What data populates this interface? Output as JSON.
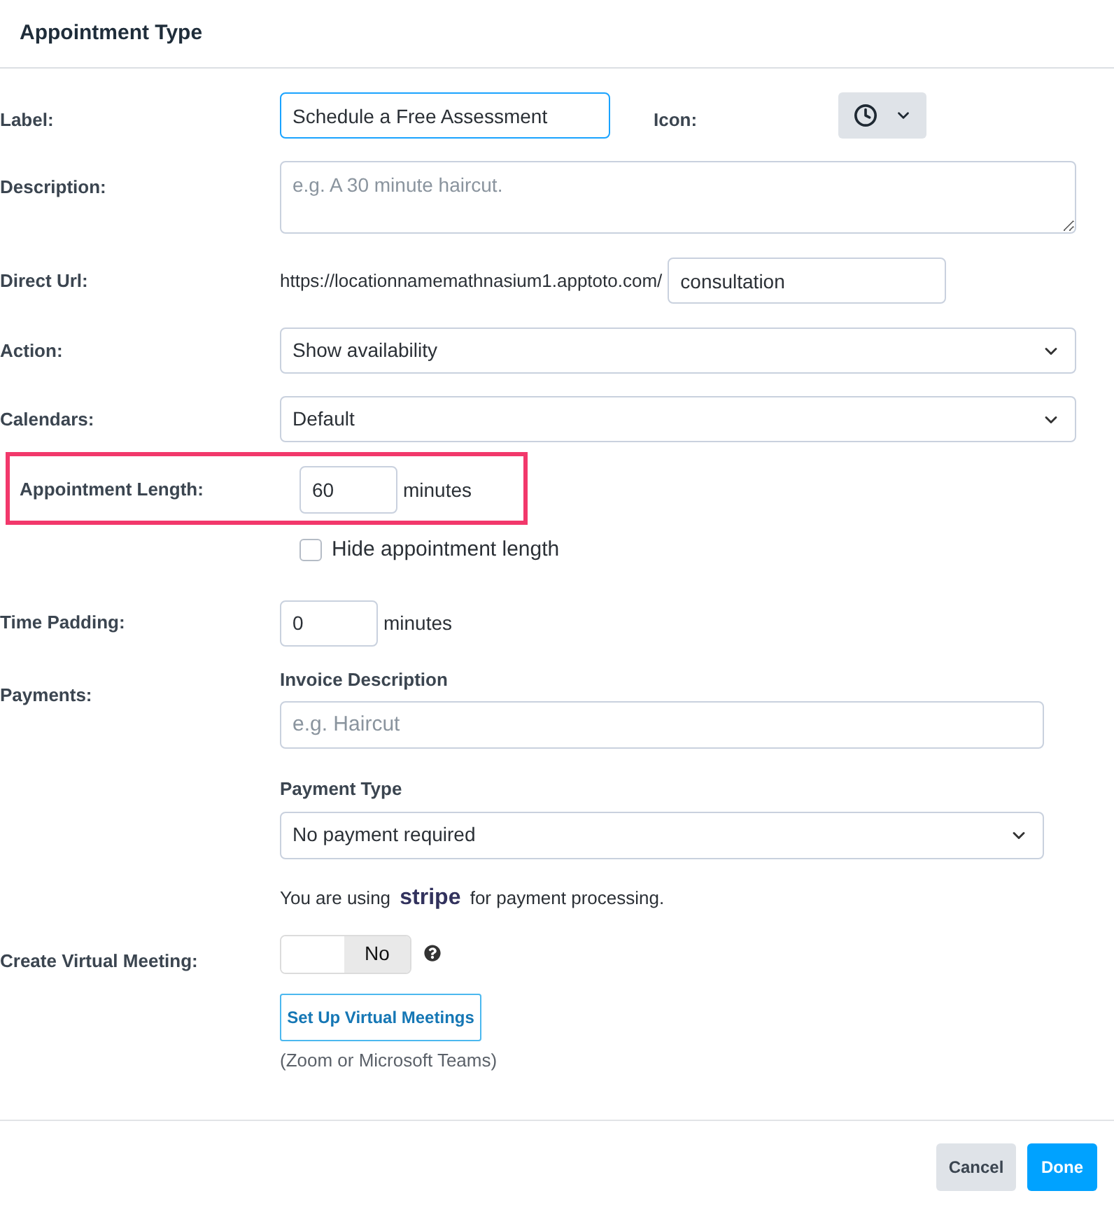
{
  "dialog": {
    "title": "Appointment Type"
  },
  "form": {
    "label": {
      "label": "Label:",
      "value": "Schedule a Free Assessment",
      "focused": true
    },
    "icon": {
      "label": "Icon:"
    },
    "description": {
      "label": "Description:",
      "placeholder": "e.g. A 30 minute haircut."
    },
    "direct_url": {
      "label": "Direct Url:",
      "prefix": "https://locationnamemathnasium1.apptoto.com/",
      "value": "consultation"
    },
    "action": {
      "label": "Action:",
      "value": "Show availability"
    },
    "calendars": {
      "label": "Calendars:",
      "value": "Default"
    },
    "appointment_length": {
      "label": "Appointment Length:",
      "value": "60",
      "unit": "minutes",
      "highlighted": true
    },
    "hide_length": {
      "label": "Hide appointment length",
      "checked": false
    },
    "time_padding": {
      "label": "Time Padding:",
      "value": "0",
      "unit": "minutes"
    },
    "payments": {
      "label": "Payments:",
      "invoice_description": {
        "label": "Invoice Description",
        "placeholder": "e.g. Haircut"
      },
      "payment_type": {
        "label": "Payment Type",
        "value": "No payment required"
      },
      "note": "You are using **stripe** for payment processing."
    },
    "virtual_meeting": {
      "label": "Create Virtual Meeting:",
      "toggle": {
        "on": false,
        "label": "No"
      },
      "setup_button": "Set Up Virtual Meetings",
      "note": "(Zoom or Microsoft Teams)"
    }
  },
  "footer": {
    "buttons": [
      {
        "label": "Cancel",
        "kind": "secondary"
      },
      {
        "label": "Done",
        "kind": "primary"
      }
    ]
  }
}
